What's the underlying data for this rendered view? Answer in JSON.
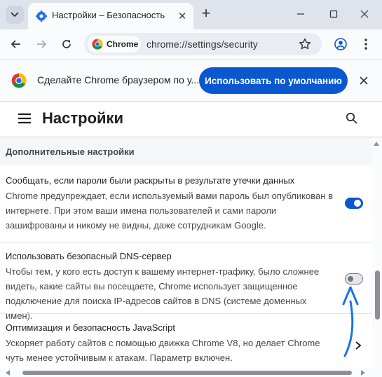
{
  "tab": {
    "title": "Настройки – Безопасность",
    "favicon": "gear-icon"
  },
  "toolbar": {
    "chip_label": "Chrome",
    "url": "chrome://settings/security"
  },
  "banner": {
    "text": "Сделайте Chrome браузером по у...",
    "button_label": "Использовать по умолчанию"
  },
  "settings": {
    "title": "Настройки",
    "section_title": "Дополнительные настройки",
    "items": [
      {
        "title": "Сообщать, если пароли были раскрыты в результате утечки данных",
        "description": "Chrome предупреждает, если используемый вами пароль был опубликован в интернете. При этом ваши имена пользователей и сами пароли зашифрованы и никому не видны, даже сотрудникам Google.",
        "enabled": true
      },
      {
        "title": "Использовать безопасный DNS-сервер",
        "description": "Чтобы тем, у кого есть доступ к вашему интернет-трафику, было сложнее видеть, какие сайты вы посещаете, Chrome использует защищенное подключение для поиска IP-адресов сайтов в DNS (системе доменных имен).",
        "enabled": false
      },
      {
        "title": "Оптимизация и безопасность JavaScript",
        "description": "Ускоряет работу сайтов с помощью движка Chrome V8, но делает Chrome чуть менее устойчивым к атакам. Параметр включен."
      }
    ]
  },
  "colors": {
    "accent": "#0b57d0",
    "annotation_arrow": "#1a73e8"
  }
}
